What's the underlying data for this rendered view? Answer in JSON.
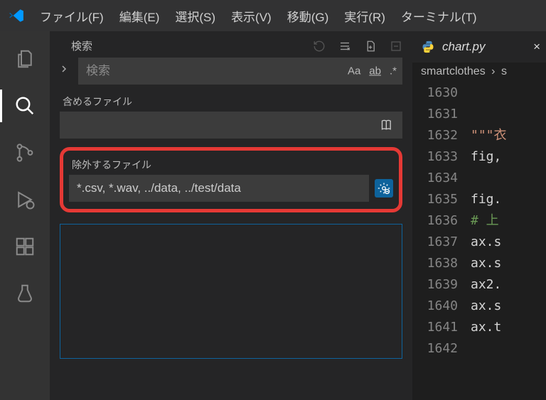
{
  "menu": {
    "items": [
      "ファイル(F)",
      "編集(E)",
      "選択(S)",
      "表示(V)",
      "移動(G)",
      "実行(R)",
      "ターミナル(T)"
    ]
  },
  "search": {
    "title": "検索",
    "placeholder": "検索",
    "opt_case": "Aa",
    "opt_word": "ab",
    "opt_regex": ".*",
    "detail_toggle": "•••",
    "include_label": "含めるファイル",
    "include_value": "",
    "exclude_label": "除外するファイル",
    "exclude_value": "*.csv, *.wav, ../data, ../test/data"
  },
  "editor": {
    "tab_file": "chart.py",
    "tab_close": "×",
    "breadcrumb_left": "smartclothes",
    "breadcrumb_sep": "›",
    "breadcrumb_right": "s",
    "lines": [
      {
        "n": "1630",
        "seg": []
      },
      {
        "n": "1631",
        "seg": []
      },
      {
        "n": "1632",
        "seg": [
          {
            "t": "\"\"\"衣",
            "c": "c-str"
          }
        ]
      },
      {
        "n": "1633",
        "seg": [
          {
            "t": "fig,",
            "c": ""
          }
        ]
      },
      {
        "n": "1634",
        "seg": []
      },
      {
        "n": "1635",
        "seg": [
          {
            "t": "fig.",
            "c": ""
          }
        ]
      },
      {
        "n": "1636",
        "seg": [
          {
            "t": "# 上",
            "c": "c-cmt"
          }
        ]
      },
      {
        "n": "1637",
        "seg": [
          {
            "t": "ax.s",
            "c": ""
          }
        ]
      },
      {
        "n": "1638",
        "seg": [
          {
            "t": "ax.s",
            "c": ""
          }
        ]
      },
      {
        "n": "1639",
        "seg": [
          {
            "t": "ax2.",
            "c": ""
          }
        ]
      },
      {
        "n": "1640",
        "seg": [
          {
            "t": "ax.s",
            "c": ""
          }
        ]
      },
      {
        "n": "1641",
        "seg": [
          {
            "t": "ax.t",
            "c": ""
          }
        ]
      },
      {
        "n": "1642",
        "seg": []
      }
    ]
  }
}
